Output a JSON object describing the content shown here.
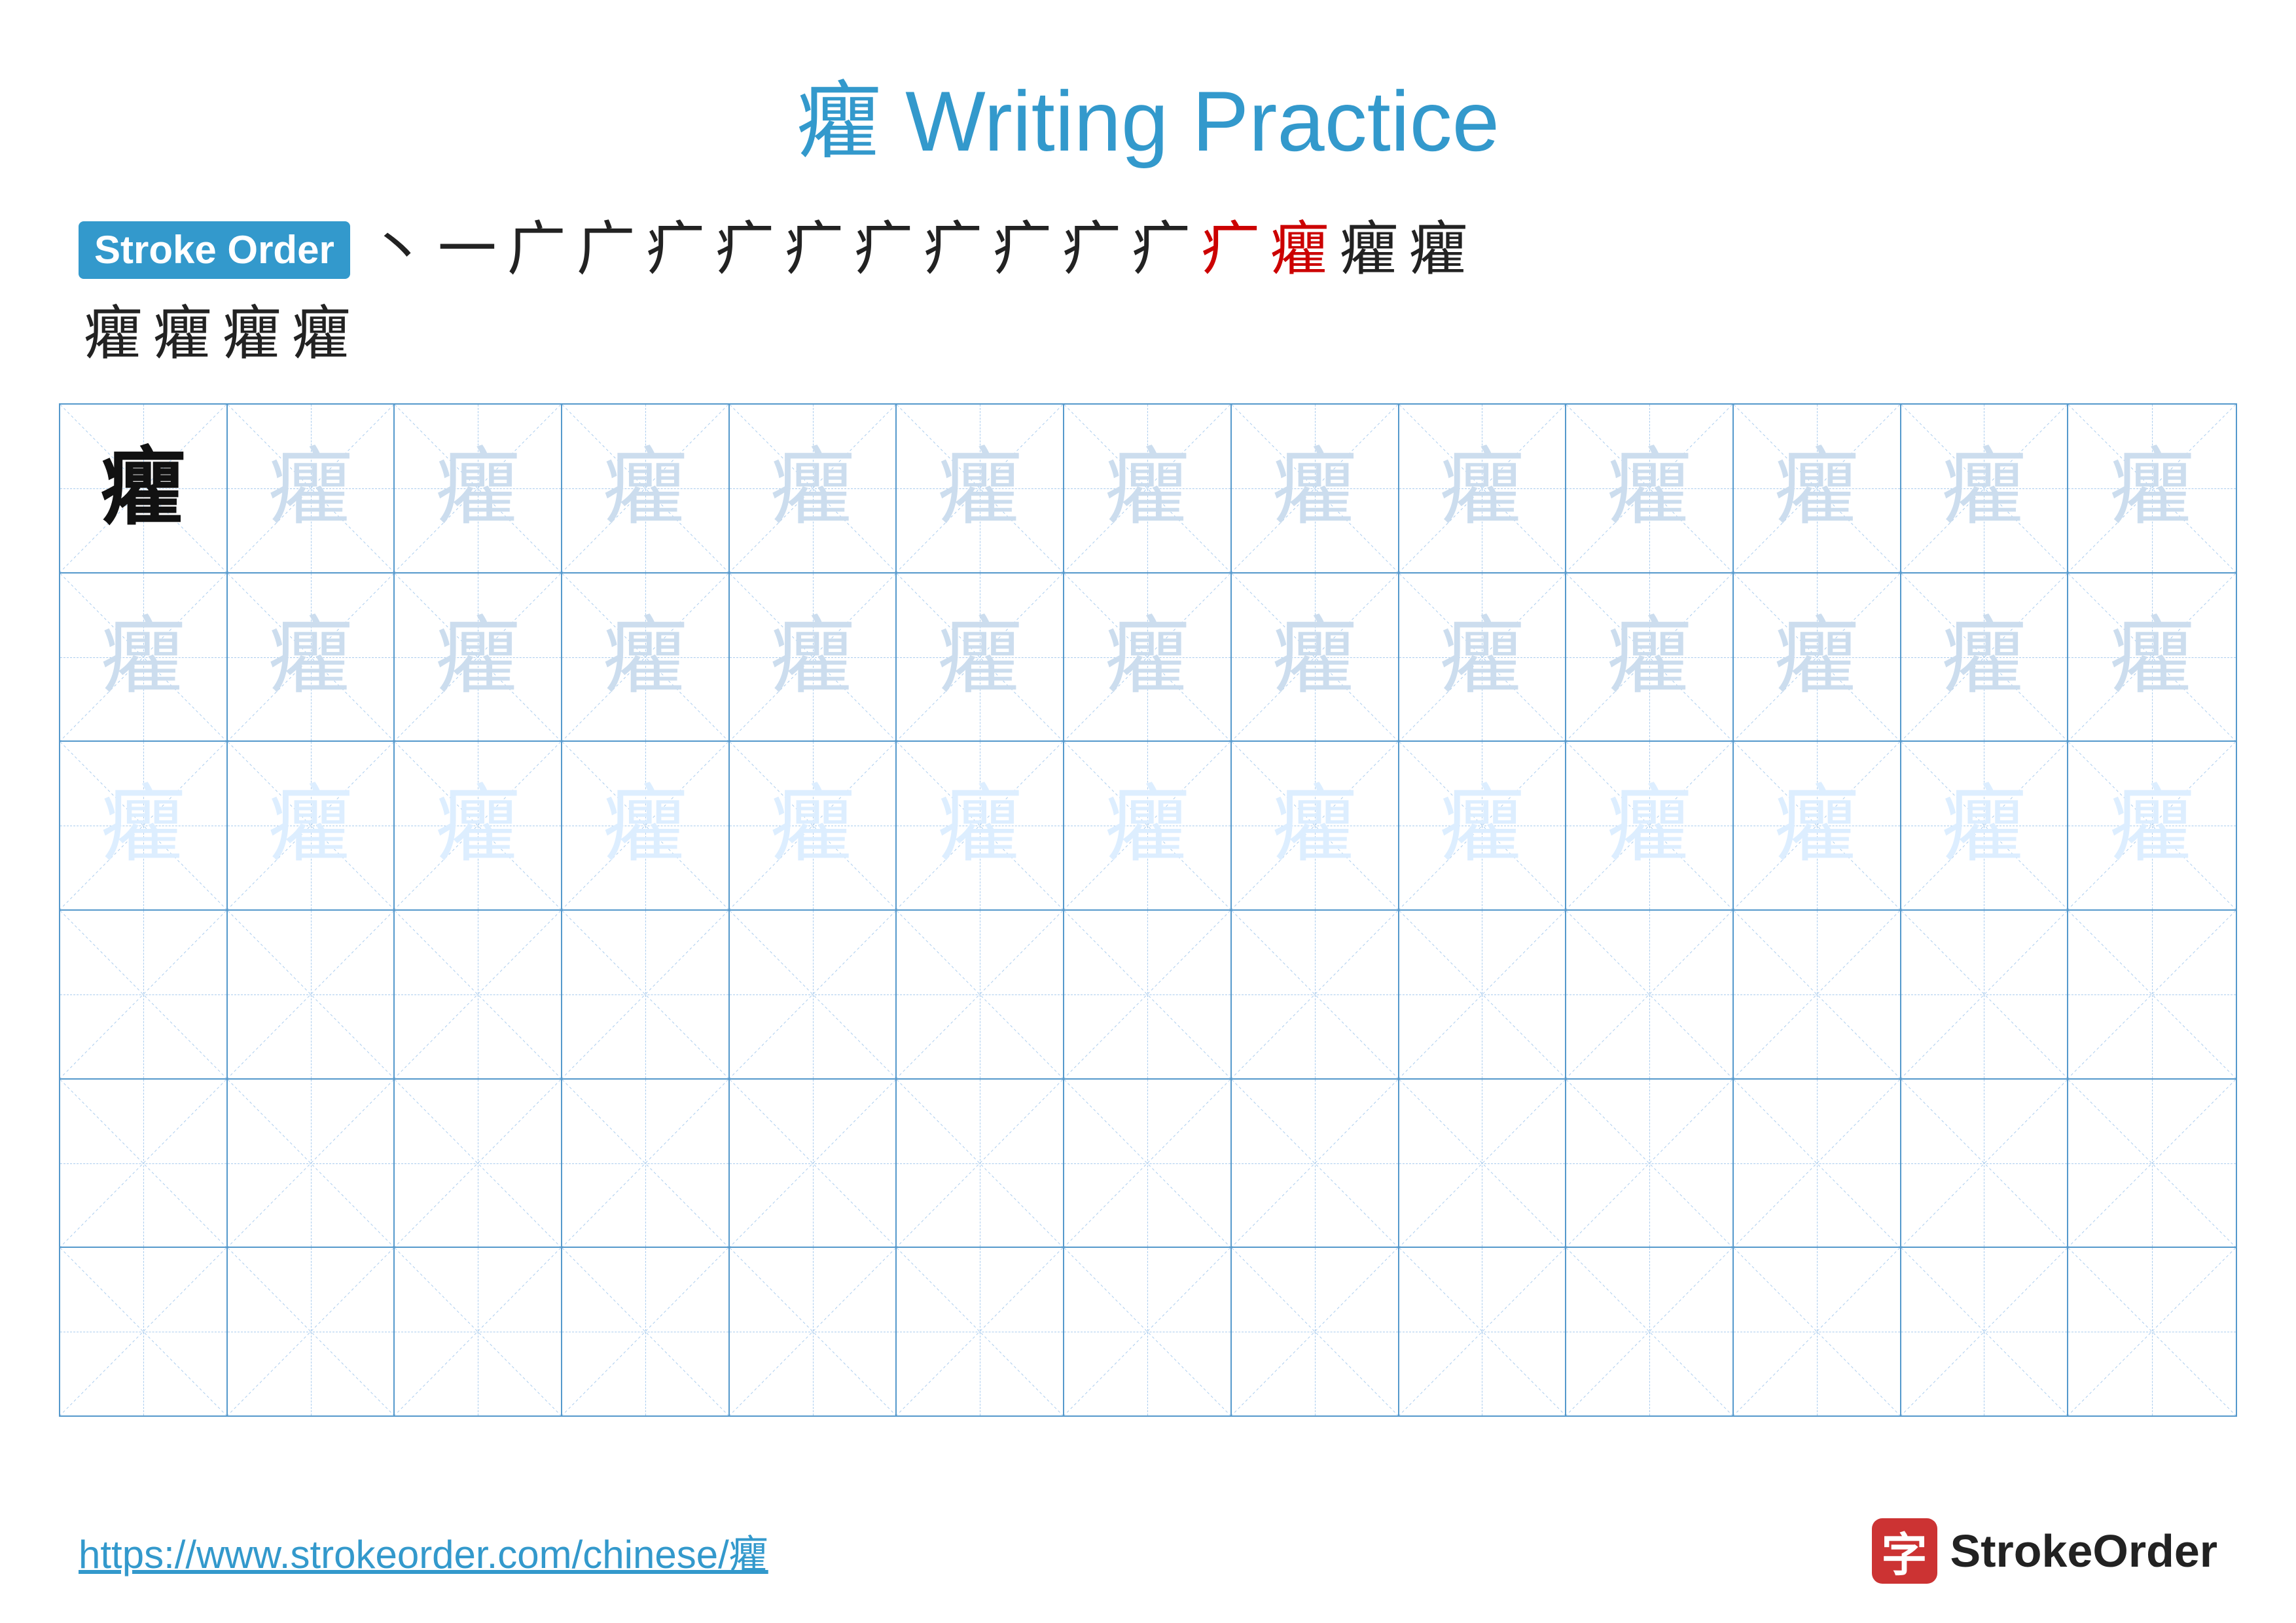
{
  "title": {
    "char": "癯",
    "label": "Writing Practice",
    "full": "癯 Writing Practice"
  },
  "stroke_order": {
    "badge_label": "Stroke Order",
    "strokes": [
      "丶",
      "一",
      "广",
      "广",
      "疒",
      "疒",
      "疒",
      "疒",
      "疒",
      "疒",
      "疒",
      "疒",
      "疒",
      "疒",
      "癯",
      "癯",
      "癯",
      "癯",
      "癯",
      "癯"
    ]
  },
  "grid": {
    "char": "癯",
    "rows": 6,
    "cols": 13,
    "row_types": [
      "solid_then_light",
      "light",
      "lighter",
      "empty",
      "empty",
      "empty"
    ]
  },
  "footer": {
    "url": "https://www.strokeorder.com/chinese/癯",
    "logo_icon": "字",
    "logo_text": "StrokeOrder"
  }
}
